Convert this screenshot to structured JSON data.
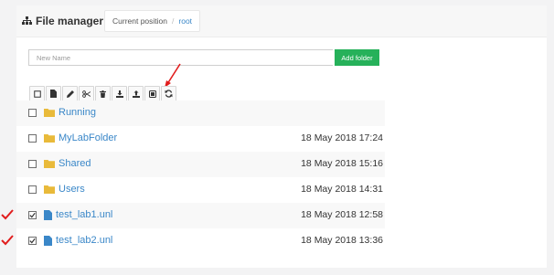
{
  "header": {
    "title": "File manager",
    "breadcrumb_label": "Current position",
    "breadcrumb_separator": "/",
    "breadcrumb_root": "root"
  },
  "new_folder": {
    "placeholder": "New Name",
    "button_label": "Add folder"
  },
  "toolbar": {
    "buttons": [
      "select-all",
      "new-file",
      "edit",
      "cut",
      "delete",
      "export",
      "import",
      "upload",
      "refresh"
    ]
  },
  "colors": {
    "accent": "#26b15a",
    "link": "#3a87c8",
    "folder": "#e9ba3a",
    "file": "#3a87c8",
    "annotation": "#e11d1d"
  },
  "files": [
    {
      "name": "Running",
      "type": "folder",
      "date": "",
      "checked": false
    },
    {
      "name": "MyLabFolder",
      "type": "folder",
      "date": "18 May 2018 17:24",
      "checked": false
    },
    {
      "name": "Shared",
      "type": "folder",
      "date": "18 May 2018 15:16",
      "checked": false
    },
    {
      "name": "Users",
      "type": "folder",
      "date": "18 May 2018 14:31",
      "checked": false
    },
    {
      "name": "test_lab1.unl",
      "type": "file",
      "date": "18 May 2018 12:58",
      "checked": true
    },
    {
      "name": "test_lab2.unl",
      "type": "file",
      "date": "18 May 2018 13:36",
      "checked": true
    }
  ]
}
